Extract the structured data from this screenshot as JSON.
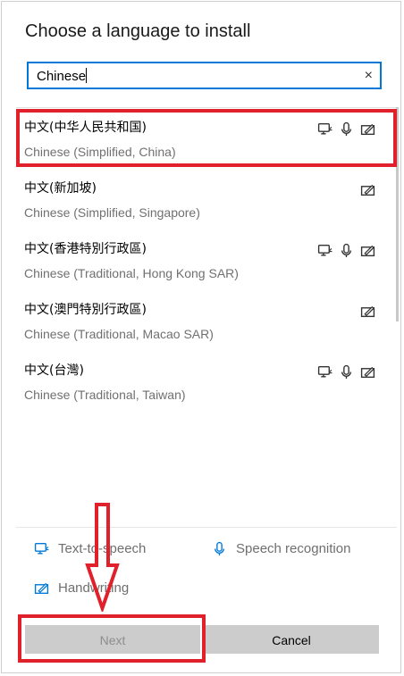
{
  "dialog": {
    "title": "Choose a language to install",
    "search": {
      "value": "Chinese",
      "clear_glyph": "×"
    }
  },
  "languages": [
    {
      "native": "中文(中华人民共和国)",
      "english": "Chinese (Simplified, China)",
      "features": [
        "text-to-speech",
        "speech-recognition",
        "handwriting"
      ],
      "selected": true
    },
    {
      "native": "中文(新加坡)",
      "english": "Chinese (Simplified, Singapore)",
      "features": [
        "handwriting"
      ],
      "selected": false
    },
    {
      "native": "中文(香港特別行政區)",
      "english": "Chinese (Traditional, Hong Kong SAR)",
      "features": [
        "text-to-speech",
        "speech-recognition",
        "handwriting"
      ],
      "selected": false
    },
    {
      "native": "中文(澳門特別行政區)",
      "english": "Chinese (Traditional, Macao SAR)",
      "features": [
        "handwriting"
      ],
      "selected": false
    },
    {
      "native": "中文(台灣)",
      "english": "Chinese (Traditional, Taiwan)",
      "features": [
        "text-to-speech",
        "speech-recognition",
        "handwriting"
      ],
      "selected": false
    }
  ],
  "legend": {
    "tts": "Text-to-speech",
    "speech": "Speech recognition",
    "handwriting": "Handwriting"
  },
  "buttons": {
    "next": "Next",
    "cancel": "Cancel",
    "next_enabled": false
  },
  "colors": {
    "accent": "#0078d7",
    "highlight": "#e0202a",
    "button_bg": "#cccccc",
    "secondary_text": "#707070"
  }
}
